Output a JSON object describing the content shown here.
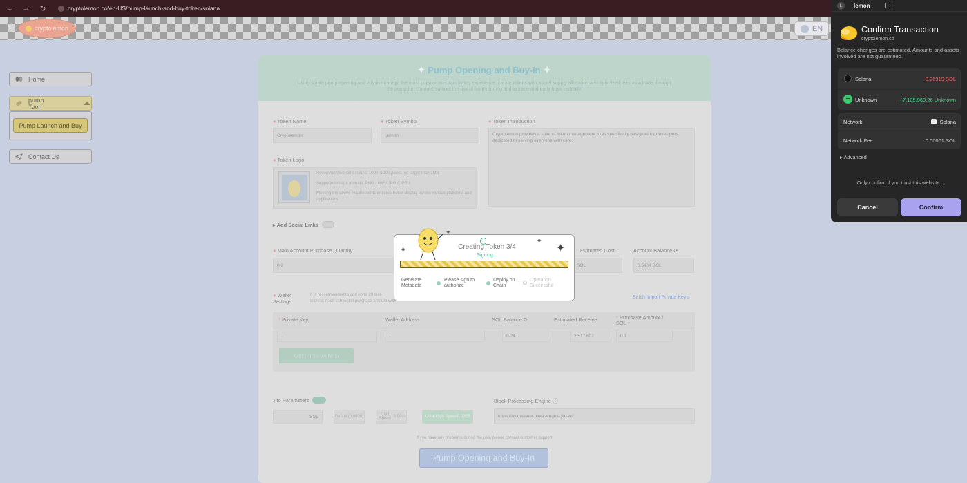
{
  "browser": {
    "url": "cryptolemon.co/en-US/pump-launch-and-buy-token/solana"
  },
  "header": {
    "logo_text": "cryptolemon",
    "lang": "EN"
  },
  "sidebar": {
    "home": "Home",
    "pump_tool": "pump Tool",
    "pump_launch": "Pump Launch and Buy",
    "contact": "Contact Us"
  },
  "main": {
    "title": "Pump Opening and Buy-In",
    "description": "Using stable pump opening and buy-in strategy, the most popular on-chain listing experience, create tokens with a total supply allocation and optimized fees as a trade through the pump.fun channel, without the risk of front-running and to trade and early buys instantly.",
    "token_name_label": "Token Name",
    "token_name_value": "Cryptolemon",
    "token_symbol_label": "Token Symbol",
    "token_symbol_value": "Lemon",
    "token_intro_label": "Token Introduction",
    "token_intro_value": "Cryptolemon provides a suite of token management tools specifically designed for developers, dedicated to serving everyone with care.",
    "token_logo_label": "Token Logo",
    "logo_hint_1": "Recommended dimensions: 1000×1000 pixels, no larger than 2MB",
    "logo_hint_2": "Supported image formats: PNG / GIF / JPG / JPEG",
    "logo_hint_3": "Meeting the above requirements ensures better display across various platforms and applications",
    "social_label": "Add Social Links",
    "main_qty_label": "Main Account Purchase Quantity",
    "main_qty_value": "0.2",
    "est_cost_label": "Estimated Cost",
    "est_cost_value": "SOL",
    "acct_balance_label": "Account Balance",
    "acct_balance_value": "0.5464 SOL",
    "wallet_settings_label": "Wallet Settings",
    "wallet_settings_hint": "It is recommended to add up to 20 sub-wallets; each sub-wallet purchase amount will be executed in one bundle with the token creation.",
    "batch_import": "Batch Import Private Keys",
    "table": {
      "headers": [
        "Private Key",
        "Wallet Address",
        "SOL Balance",
        "Estimated Receive",
        "Purchase Amount / SOL"
      ],
      "row": [
        "..",
        "...",
        "0.24...",
        "2,517,602",
        "0.1"
      ]
    },
    "add_wallets": "Add (more wallets)",
    "jito_label": "Jito Parameters",
    "jito_unit": "SOL",
    "jito_options": [
      {
        "name": "Default",
        "value": "(0.0005)"
      },
      {
        "name": "High Speed",
        "value": "0.0001"
      },
      {
        "name": "Ultra-High Speed",
        "value": "0.0005"
      }
    ],
    "block_engine_label": "Block Processing Engine",
    "block_engine_value": "https://ny.mainnet.block-engine.jito.wtf",
    "footer_note": "If you have any problems during the use, please contact customer support",
    "submit": "Pump Opening and Buy-In"
  },
  "modal": {
    "title": "Creating Token 3/4",
    "status": "Signing...",
    "progress": 1.0,
    "steps": [
      {
        "label": "Generate Metadata"
      },
      {
        "label": "Please sign to authorize"
      },
      {
        "label": "Deploy on Chain"
      },
      {
        "label": "Operation Successful"
      }
    ]
  },
  "wallet": {
    "avatar": "L",
    "name": "lemon",
    "title": "Confirm Transaction",
    "site": "cryptolemon.co",
    "note": "Balance changes are estimated. Amounts and assets involved are not guaranteed.",
    "changes": [
      {
        "asset": "Solana",
        "amount": "-0.26919 SOL",
        "color": "#f16b6b"
      },
      {
        "asset": "Unknown",
        "amount": "+7,105,960.26 Unknown",
        "color": "#4ddb87"
      }
    ],
    "network_label": "Network",
    "network_value": "Solana",
    "fee_label": "Network Fee",
    "fee_value": "0.00001 SOL",
    "advanced": "Advanced",
    "trust_note": "Only confirm if you trust this website.",
    "cancel": "Cancel",
    "confirm": "Confirm"
  },
  "colors": {
    "accent": "#a9a3ef",
    "mint": "#bdd5cb",
    "lemon": "#e6c84a"
  }
}
